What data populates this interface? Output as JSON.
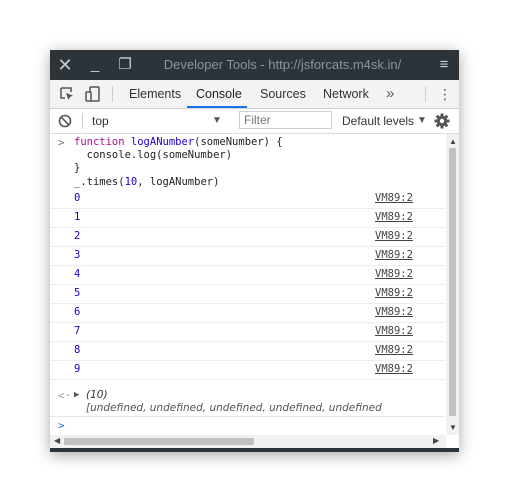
{
  "window": {
    "title": "Developer Tools - http://jsforcats.m4sk.in/",
    "close_glyph": "✕",
    "minimize_glyph": "_",
    "maximize_glyph": "❐",
    "menu_glyph": "≡"
  },
  "tabs": {
    "elements": "Elements",
    "console": "Console",
    "sources": "Sources",
    "network": "Network",
    "more": "»",
    "kebab": "⋮",
    "active": "Console",
    "accent": "#1a73e8"
  },
  "toolbar": {
    "context": "top",
    "filter_placeholder": "Filter",
    "filter_value": "",
    "levels": "Default levels",
    "dropdown_glyph": "▼"
  },
  "console": {
    "input_prompt": ">",
    "code": {
      "l1_kw": "function",
      "l1_name": "logANumber",
      "l1_rest": "(someNumber) {",
      "l2": "  console.log(someNumber)",
      "l3": "}",
      "l4_prefix": "_.times(",
      "l4_num": "10",
      "l4_suffix": ", logANumber)"
    },
    "logs": [
      {
        "value": "0",
        "source": "VM89:2"
      },
      {
        "value": "1",
        "source": "VM89:2"
      },
      {
        "value": "2",
        "source": "VM89:2"
      },
      {
        "value": "3",
        "source": "VM89:2"
      },
      {
        "value": "4",
        "source": "VM89:2"
      },
      {
        "value": "5",
        "source": "VM89:2"
      },
      {
        "value": "6",
        "source": "VM89:2"
      },
      {
        "value": "7",
        "source": "VM89:2"
      },
      {
        "value": "8",
        "source": "VM89:2"
      },
      {
        "value": "9",
        "source": "VM89:2"
      }
    ],
    "return_mark": "<·",
    "expand_glyph": "▶",
    "return_count": "(10)",
    "return_array": "[undefined, undefined, undefined, undefined, undefined",
    "prompt_caret": ">"
  },
  "colors": {
    "titlebar": "#2c3339",
    "number_blue": "#1c00cf",
    "keyword": "#aa0d91"
  }
}
